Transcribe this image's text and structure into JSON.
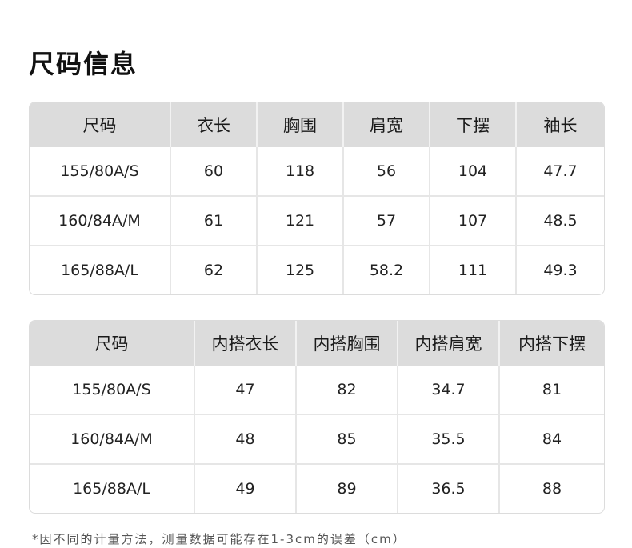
{
  "title": "尺码信息",
  "table1": {
    "headers": [
      "尺码",
      "衣长",
      "胸围",
      "肩宽",
      "下摆",
      "袖长"
    ],
    "rows": [
      [
        "155/80A/S",
        "60",
        "118",
        "56",
        "104",
        "47.7"
      ],
      [
        "160/84A/M",
        "61",
        "121",
        "57",
        "107",
        "48.5"
      ],
      [
        "165/88A/L",
        "62",
        "125",
        "58.2",
        "111",
        "49.3"
      ]
    ]
  },
  "table2": {
    "headers": [
      "尺码",
      "内搭衣长",
      "内搭胸围",
      "内搭肩宽",
      "内搭下摆"
    ],
    "rows": [
      [
        "155/80A/S",
        "47",
        "82",
        "34.7",
        "81"
      ],
      [
        "160/84A/M",
        "48",
        "85",
        "35.5",
        "84"
      ],
      [
        "165/88A/L",
        "49",
        "89",
        "36.5",
        "88"
      ]
    ]
  },
  "footnote": "*因不同的计量方法，测量数据可能存在1-3cm的误差（cm）",
  "colors": {
    "header_bg": "#dcdcdc",
    "grid_line": "#e6e6e6",
    "text": "#1a1a1a"
  }
}
